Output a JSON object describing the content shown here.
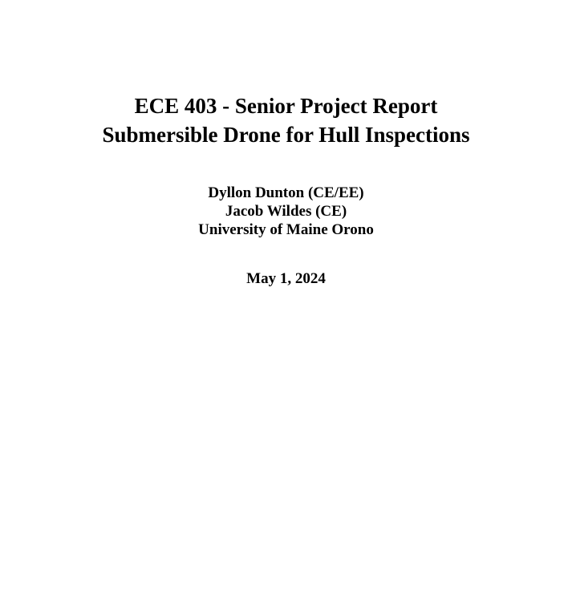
{
  "report": {
    "title_line_1": "ECE 403 - Senior Project Report",
    "title_line_2": "Submersible Drone for Hull Inspections",
    "authors": [
      "Dyllon Dunton (CE/EE)",
      "Jacob Wildes (CE)"
    ],
    "institution": "University of Maine Orono",
    "date": "May 1, 2024"
  },
  "colors": {
    "background": "#ffffff",
    "text": "#000000"
  }
}
